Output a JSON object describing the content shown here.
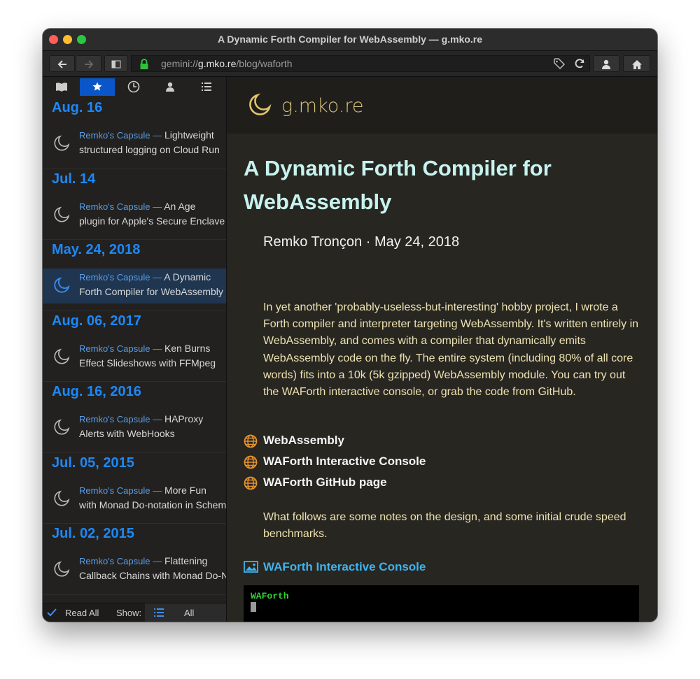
{
  "window": {
    "title": "A Dynamic Forth Compiler for WebAssembly — g.mko.re"
  },
  "toolbar": {
    "url_scheme": "gemini://",
    "url_host": "g.mko.re",
    "url_path": "/blog/waforth",
    "back_icon": "arrow-left-icon",
    "forward_icon": "arrow-right-icon"
  },
  "sidebar": {
    "tabs": [
      "book-icon",
      "star-icon",
      "clock-icon",
      "person-icon",
      "list-icon"
    ],
    "entries": [
      {
        "date": "Aug. 16",
        "capsule": "Remko's Capsule —",
        "line1": " Lightweight",
        "line2": "structured logging on Cloud Run"
      },
      {
        "date": "Jul. 14",
        "capsule": "Remko's Capsule —",
        "line1": " An Age",
        "line2": "plugin for Apple's Secure Enclave"
      },
      {
        "date": "May. 24, 2018",
        "capsule": "Remko's Capsule —",
        "line1": " A Dynamic",
        "line2": "Forth Compiler for WebAssembly"
      },
      {
        "date": "Aug. 06, 2017",
        "capsule": "Remko's Capsule —",
        "line1": " Ken Burns",
        "line2": "Effect Slideshows with FFMpeg"
      },
      {
        "date": "Aug. 16, 2016",
        "capsule": "Remko's Capsule —",
        "line1": " HAProxy",
        "line2": "Alerts with WebHooks"
      },
      {
        "date": "Jul. 05, 2015",
        "capsule": "Remko's Capsule —",
        "line1": " More Fun",
        "line2": "with Monad Do-notation in Scheme"
      },
      {
        "date": "Jul. 02, 2015",
        "capsule": "Remko's Capsule —",
        "line1": " Flattening",
        "line2": "Callback Chains with Monad Do-Not"
      }
    ],
    "footer": {
      "read_all": "Read All",
      "show": "Show:",
      "filter": "All"
    }
  },
  "content": {
    "site_title": "g.mko.re",
    "title": "A Dynamic Forth Compiler for WebAssembly",
    "byline": "Remko Tronçon · May 24, 2018",
    "intro": "In yet another 'probably-useless-but-interesting' hobby project, I wrote a Forth compiler and interpreter targeting WebAssembly. It's written entirely in WebAssembly, and comes with a compiler that dynamically emits WebAssembly code on the fly. The entire system (including 80% of all core words) fits into a 10k (5k gzipped) WebAssembly module. You can try out the WAForth interactive console, or grab the code from GitHub.",
    "links": [
      "WebAssembly",
      "WAForth Interactive Console",
      "WAForth GitHub page"
    ],
    "follow": "What follows are some notes on the design, and some initial crude speed benchmarks.",
    "image_link": "WAForth Interactive Console",
    "console_text": "WAForth"
  }
}
